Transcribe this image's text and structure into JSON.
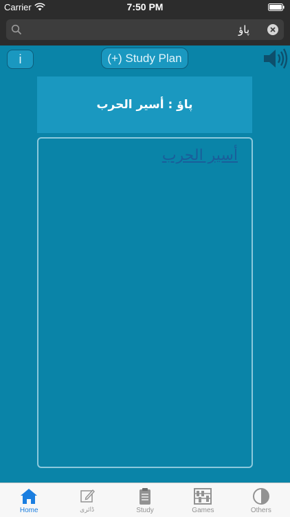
{
  "status_bar": {
    "carrier": "Carrier",
    "time": "7:50 PM"
  },
  "search": {
    "value": "پاؤ"
  },
  "toolbar": {
    "info_label": "i",
    "study_plan_label": "(+) Study Plan"
  },
  "entry": {
    "title": "پاؤ : أسير الحرب",
    "definition_link": "أسير الحرب"
  },
  "tab_bar": {
    "items": [
      {
        "label": "Home",
        "icon": "home-icon",
        "active": true
      },
      {
        "label": "ڈائری",
        "icon": "edit-icon",
        "active": false
      },
      {
        "label": "Study",
        "icon": "clipboard-icon",
        "active": false
      },
      {
        "label": "Games",
        "icon": "abacus-icon",
        "active": false
      },
      {
        "label": "Others",
        "icon": "half-circle-icon",
        "active": false
      }
    ]
  },
  "colors": {
    "background": "#0a84a8",
    "panel": "#1a98c0",
    "active_tab": "#1a7ee0",
    "link": "#1a5e9a"
  }
}
